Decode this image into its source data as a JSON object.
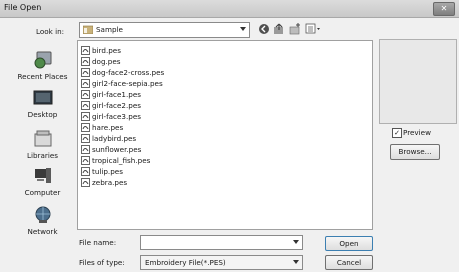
{
  "window": {
    "title": "File Open",
    "close_label": "✕"
  },
  "lookin": {
    "label": "Look in:",
    "value": "Sample"
  },
  "toolbar": {
    "icons": [
      "back-icon",
      "up-folder-icon",
      "new-folder-icon",
      "view-menu-icon"
    ]
  },
  "places": [
    {
      "label": "Recent Places",
      "icon": "recent-places-icon"
    },
    {
      "label": "Desktop",
      "icon": "desktop-icon"
    },
    {
      "label": "Libraries",
      "icon": "libraries-icon"
    },
    {
      "label": "Computer",
      "icon": "computer-icon"
    },
    {
      "label": "Network",
      "icon": "network-icon"
    }
  ],
  "files": [
    "bird.pes",
    "dog.pes",
    "dog-face2-cross.pes",
    "girl2-face-sepia.pes",
    "girl-face1.pes",
    "girl-face2.pes",
    "girl-face3.pes",
    "hare.pes",
    "ladybird.pes",
    "sunflower.pes",
    "tropical_fish.pes",
    "tulip.pes",
    "zebra.pes"
  ],
  "preview": {
    "label": "Preview",
    "checked": true,
    "check_mark": "✓",
    "browse_label": "Browse..."
  },
  "filename": {
    "label": "File name:",
    "value": ""
  },
  "filetype": {
    "label": "Files of type:",
    "value": "Embroidery File(*.PES)"
  },
  "buttons": {
    "open": "Open",
    "cancel": "Cancel"
  }
}
